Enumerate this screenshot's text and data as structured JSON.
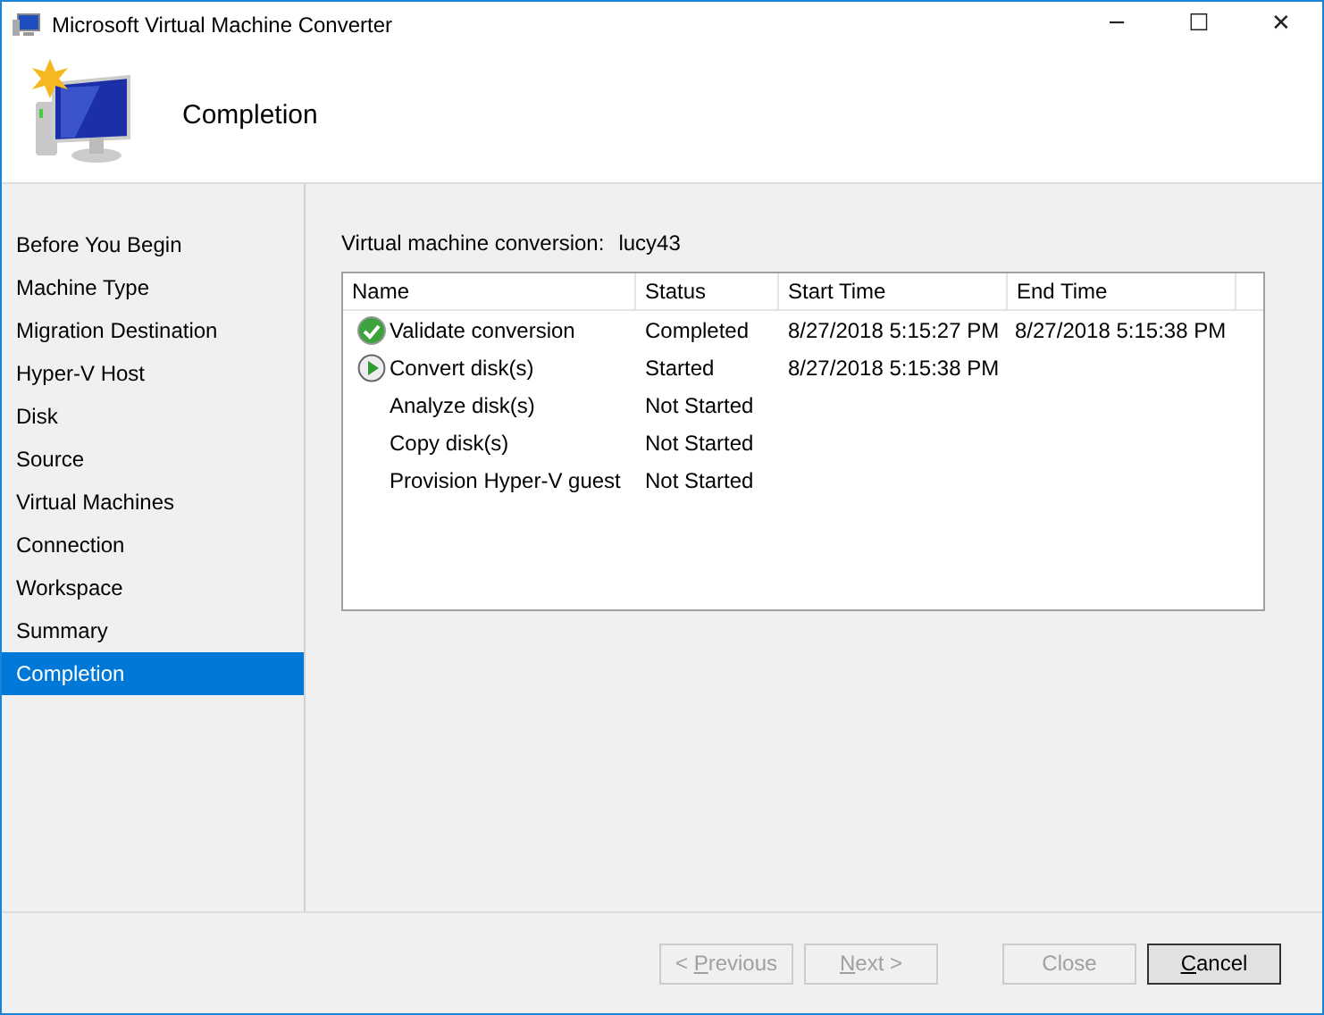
{
  "window": {
    "title": "Microsoft Virtual Machine Converter",
    "controls": [
      "─",
      "☐",
      "✕"
    ]
  },
  "header": {
    "title": "Completion"
  },
  "sidebar": {
    "items": [
      {
        "label": "Before You Begin",
        "selected": false
      },
      {
        "label": "Machine Type",
        "selected": false
      },
      {
        "label": "Migration Destination",
        "selected": false
      },
      {
        "label": "Hyper-V Host",
        "selected": false
      },
      {
        "label": "Disk",
        "selected": false
      },
      {
        "label": "Source",
        "selected": false
      },
      {
        "label": "Virtual Machines",
        "selected": false
      },
      {
        "label": "Connection",
        "selected": false
      },
      {
        "label": "Workspace",
        "selected": false
      },
      {
        "label": "Summary",
        "selected": false
      },
      {
        "label": "Completion",
        "selected": true
      }
    ]
  },
  "conversion": {
    "label": "Virtual machine conversion:",
    "value": "lucy43"
  },
  "table": {
    "columns": [
      "Name",
      "Status",
      "Start Time",
      "End Time"
    ],
    "rows": [
      {
        "kind": "completed",
        "name": "Validate conversion",
        "status": "Completed",
        "start": "8/27/2018 5:15:27 PM",
        "end": "8/27/2018 5:15:38 PM"
      },
      {
        "kind": "started",
        "name": "Convert disk(s)",
        "status": "Started",
        "start": "8/27/2018 5:15:38 PM"
      },
      {
        "kind": "pending",
        "name": "Analyze disk(s)",
        "status": "Not Started"
      },
      {
        "kind": "pending",
        "name": "Copy disk(s)",
        "status": "Not Started"
      },
      {
        "kind": "pending",
        "name": "Provision Hyper-V guest",
        "status": "Not Started"
      }
    ]
  },
  "buttons": [
    {
      "before": "< ",
      "accelerator": "P",
      "after": "revious",
      "disabled": true
    },
    {
      "accelerator": "N",
      "after": "ext >",
      "disabled": true
    },
    {
      "before": "Close",
      "disabled": true
    },
    {
      "accelerator": "C",
      "after": "ancel",
      "disabled": false
    }
  ]
}
